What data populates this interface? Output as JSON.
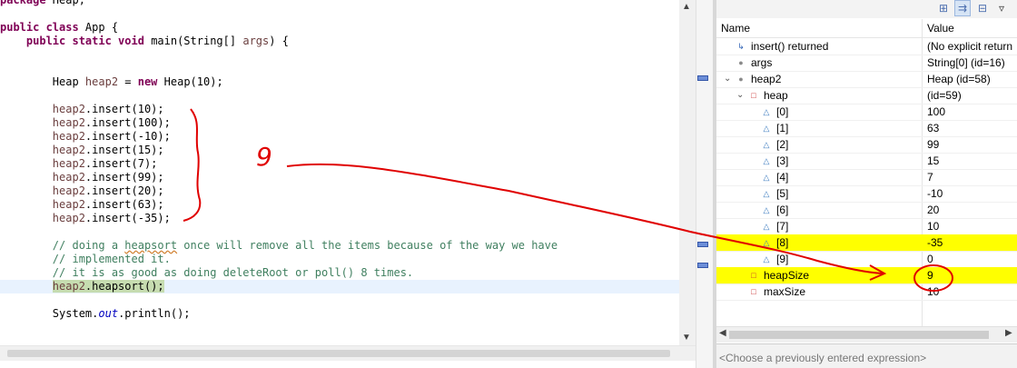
{
  "editor": {
    "lines": [
      {
        "parts": [
          {
            "t": "package ",
            "c": "kw"
          },
          {
            "t": "Heap;"
          }
        ]
      },
      {
        "parts": [
          {
            "t": ""
          }
        ]
      },
      {
        "parts": [
          {
            "t": "public class ",
            "c": "kw"
          },
          {
            "t": "App {"
          }
        ]
      },
      {
        "parts": [
          {
            "t": "    "
          },
          {
            "t": "public static void ",
            "c": "kw"
          },
          {
            "t": "main(String[] "
          },
          {
            "t": "args",
            "c": "str-par"
          },
          {
            "t": ") {"
          }
        ]
      },
      {
        "parts": [
          {
            "t": ""
          }
        ]
      },
      {
        "parts": [
          {
            "t": ""
          }
        ]
      },
      {
        "parts": [
          {
            "t": "        Heap "
          },
          {
            "t": "heap2",
            "c": "str-par"
          },
          {
            "t": " = "
          },
          {
            "t": "new ",
            "c": "kw"
          },
          {
            "t": "Heap(10);"
          }
        ]
      },
      {
        "parts": [
          {
            "t": ""
          }
        ]
      },
      {
        "parts": [
          {
            "t": "        "
          },
          {
            "t": "heap2",
            "c": "str-par"
          },
          {
            "t": ".insert(10);"
          }
        ]
      },
      {
        "parts": [
          {
            "t": "        "
          },
          {
            "t": "heap2",
            "c": "str-par"
          },
          {
            "t": ".insert(100);"
          }
        ]
      },
      {
        "parts": [
          {
            "t": "        "
          },
          {
            "t": "heap2",
            "c": "str-par"
          },
          {
            "t": ".insert(-10);"
          }
        ]
      },
      {
        "parts": [
          {
            "t": "        "
          },
          {
            "t": "heap2",
            "c": "str-par"
          },
          {
            "t": ".insert(15);"
          }
        ]
      },
      {
        "parts": [
          {
            "t": "        "
          },
          {
            "t": "heap2",
            "c": "str-par"
          },
          {
            "t": ".insert(7);"
          }
        ]
      },
      {
        "parts": [
          {
            "t": "        "
          },
          {
            "t": "heap2",
            "c": "str-par"
          },
          {
            "t": ".insert(99);"
          }
        ]
      },
      {
        "parts": [
          {
            "t": "        "
          },
          {
            "t": "heap2",
            "c": "str-par"
          },
          {
            "t": ".insert(20);"
          }
        ]
      },
      {
        "parts": [
          {
            "t": "        "
          },
          {
            "t": "heap2",
            "c": "str-par"
          },
          {
            "t": ".insert(63);"
          }
        ]
      },
      {
        "parts": [
          {
            "t": "        "
          },
          {
            "t": "heap2",
            "c": "str-par"
          },
          {
            "t": ".insert(-35);"
          }
        ]
      },
      {
        "parts": [
          {
            "t": ""
          }
        ]
      },
      {
        "parts": [
          {
            "t": "        // doing a ",
            "c": "cm"
          },
          {
            "t": "heapsort",
            "c": "cm squig"
          },
          {
            "t": " once will remove all the items because of the way we have",
            "c": "cm"
          }
        ]
      },
      {
        "parts": [
          {
            "t": "        // implemented it.",
            "c": "cm"
          }
        ]
      },
      {
        "parts": [
          {
            "t": "        // it is as good as doing deleteRoot or poll() 8 times.",
            "c": "cm"
          }
        ]
      },
      {
        "parts": [
          {
            "t": "        "
          },
          {
            "t": "heap2",
            "c": "str-par exec-hl"
          },
          {
            "t": ".heapsort();",
            "c": "exec-hl"
          }
        ],
        "current": true
      },
      {
        "parts": [
          {
            "t": ""
          }
        ]
      },
      {
        "parts": [
          {
            "t": "        System."
          },
          {
            "t": "out",
            "c": "fld"
          },
          {
            "t": ".println();"
          }
        ]
      }
    ]
  },
  "variables": {
    "header": {
      "name": "Name",
      "value": "Value"
    },
    "rows": [
      {
        "twisty": "",
        "icon": "return-icon",
        "icon_glyph": "↳",
        "icon_class": "ic-ret",
        "name": "insert() returned",
        "value": "(No explicit return",
        "indent": 0
      },
      {
        "twisty": "",
        "icon": "local-variable-icon",
        "icon_glyph": "●",
        "icon_class": "ic-local",
        "name": "args",
        "value": "String[0]  (id=16)",
        "indent": 0
      },
      {
        "twisty": "v",
        "icon": "local-variable-icon",
        "icon_glyph": "●",
        "icon_class": "ic-local",
        "name": "heap2",
        "value": "Heap  (id=58)",
        "indent": 0
      },
      {
        "twisty": "v",
        "icon": "private-field-icon",
        "icon_glyph": "□",
        "icon_class": "ic-field",
        "name": "heap",
        "value": "(id=59)",
        "indent": 1
      },
      {
        "twisty": "",
        "icon": "array-element-icon",
        "icon_glyph": "△",
        "icon_class": "ic-arr",
        "name": "[0]",
        "value": "100",
        "indent": 2
      },
      {
        "twisty": "",
        "icon": "array-element-icon",
        "icon_glyph": "△",
        "icon_class": "ic-arr",
        "name": "[1]",
        "value": "63",
        "indent": 2
      },
      {
        "twisty": "",
        "icon": "array-element-icon",
        "icon_glyph": "△",
        "icon_class": "ic-arr",
        "name": "[2]",
        "value": "99",
        "indent": 2
      },
      {
        "twisty": "",
        "icon": "array-element-icon",
        "icon_glyph": "△",
        "icon_class": "ic-arr",
        "name": "[3]",
        "value": "15",
        "indent": 2
      },
      {
        "twisty": "",
        "icon": "array-element-icon",
        "icon_glyph": "△",
        "icon_class": "ic-arr",
        "name": "[4]",
        "value": "7",
        "indent": 2
      },
      {
        "twisty": "",
        "icon": "array-element-icon",
        "icon_glyph": "△",
        "icon_class": "ic-arr",
        "name": "[5]",
        "value": "-10",
        "indent": 2
      },
      {
        "twisty": "",
        "icon": "array-element-icon",
        "icon_glyph": "△",
        "icon_class": "ic-arr",
        "name": "[6]",
        "value": "20",
        "indent": 2
      },
      {
        "twisty": "",
        "icon": "array-element-icon",
        "icon_glyph": "△",
        "icon_class": "ic-arr",
        "name": "[7]",
        "value": "10",
        "indent": 2
      },
      {
        "twisty": "",
        "icon": "array-element-icon",
        "icon_glyph": "△",
        "icon_class": "ic-arr",
        "name": "[8]",
        "value": "-35",
        "indent": 2,
        "highlight": true
      },
      {
        "twisty": "",
        "icon": "array-element-icon",
        "icon_glyph": "△",
        "icon_class": "ic-arr",
        "name": "[9]",
        "value": "0",
        "indent": 2
      },
      {
        "twisty": "",
        "icon": "private-field-icon",
        "icon_glyph": "□",
        "icon_class": "ic-field",
        "name": "heapSize",
        "value": "9",
        "indent": 1,
        "highlight": true
      },
      {
        "twisty": "",
        "icon": "private-field-icon",
        "icon_glyph": "□",
        "icon_class": "ic-field",
        "name": "maxSize",
        "value": "10",
        "indent": 1
      }
    ],
    "expression_placeholder": "<Choose a previously entered expression>"
  },
  "annotation": {
    "number": "9",
    "ink_color": "#e00000"
  },
  "colors": {
    "highlight": "#ffff00",
    "current_line": "#e8f2fe",
    "exec_highlight": "#c6dcb0",
    "keyword": "#7f0055",
    "comment": "#3f7f5f"
  }
}
